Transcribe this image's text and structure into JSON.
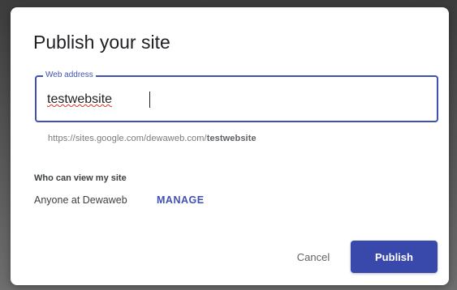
{
  "dialog": {
    "title": "Publish your site",
    "web_address": {
      "label": "Web address",
      "value": "testwebsite"
    },
    "url_hint": {
      "prefix": "https://sites.google.com/dewaweb.com/",
      "slug": "testwebsite"
    },
    "visibility": {
      "label": "Who can view my site",
      "audience": "Anyone at Dewaweb",
      "manage_label": "MANAGE"
    },
    "actions": {
      "cancel_label": "Cancel",
      "publish_label": "Publish"
    }
  },
  "colors": {
    "accent": "#3f51b5",
    "primary_button": "#3949ab",
    "spellcheck_underline": "#d93025"
  }
}
